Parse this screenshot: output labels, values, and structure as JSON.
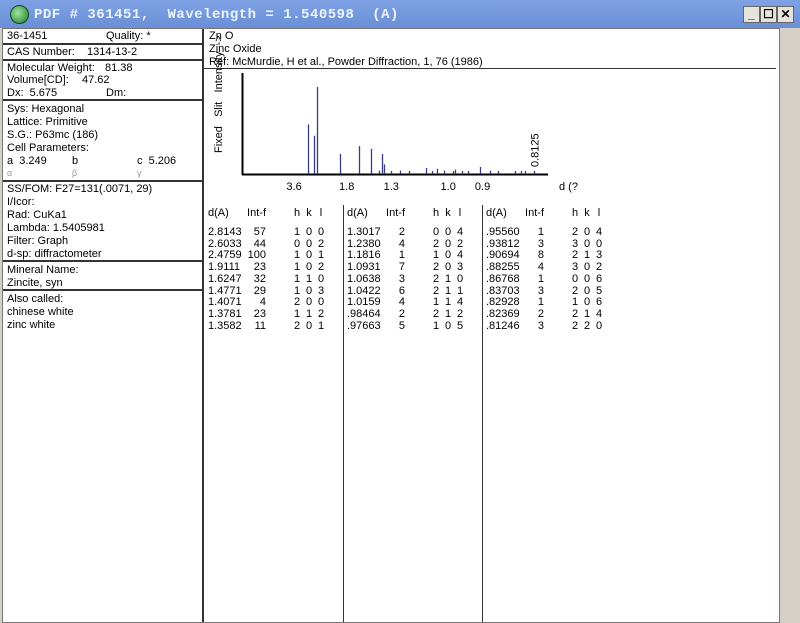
{
  "window": {
    "title": "PDF # 361451,  Wavelength = 1.540598  (A)",
    "minimize": "_",
    "maximize": "☐",
    "close": "✕"
  },
  "left": {
    "pdf_number": "36-1451",
    "quality": "Quality: *",
    "cas_label": "CAS Number:",
    "cas_value": "1314-13-2",
    "mw_label": "Molecular Weight:",
    "mw_value": "81.38",
    "vol_label": "Volume[CD]:",
    "vol_value": "47.62",
    "dx": "Dx:  5.675",
    "dm": "Dm:",
    "sys": "Sys: Hexagonal",
    "lattice": "Lattice: Primitive",
    "sg": "S.G.: P63mc (186)",
    "cell_label": "Cell Parameters:",
    "a": "a  3.249",
    "b": "b",
    "c": "c  5.206",
    "alpha": "α",
    "beta": "β",
    "gamma": "γ",
    "ssfom": "SS/FOM: F27=131(.0071, 29)",
    "icor": "I/Icor:",
    "rad": "Rad: CuKa1",
    "lambda": "Lambda: 1.5405981",
    "filter": "Filter: Graph",
    "dsp": "d-sp: diffractometer",
    "mineral_label": "Mineral Name:",
    "mineral": "Zincite, syn",
    "also_label": "Also called:",
    "also": [
      "chinese white",
      "zinc white"
    ]
  },
  "header": {
    "formula": "Zn O",
    "name": "Zinc Oxide",
    "ref": "Ref: McMurdie, H et al., Powder Diffraction, 1, 76 (1986)"
  },
  "chart_data": {
    "type": "bar",
    "ylabel": "Fixed   Slit   Intensity  ->",
    "xlabel": "d (?",
    "xticks": [
      "3.6",
      "1.8",
      "1.3",
      "1.0",
      "0.9"
    ],
    "xtick_values": [
      3.6,
      1.8,
      1.3,
      1.0,
      0.9
    ],
    "annotation": "0.8125",
    "wavelength": 1.540598,
    "x_range_2theta": [
      0,
      150
    ],
    "ylim": [
      0,
      100
    ],
    "peaks": [
      [
        2.8143,
        57
      ],
      [
        2.6033,
        44
      ],
      [
        2.4759,
        100
      ],
      [
        1.9111,
        23
      ],
      [
        1.6247,
        32
      ],
      [
        1.4771,
        29
      ],
      [
        1.4071,
        4
      ],
      [
        1.3781,
        23
      ],
      [
        1.3582,
        11
      ],
      [
        1.3017,
        2
      ],
      [
        1.238,
        4
      ],
      [
        1.1816,
        1
      ],
      [
        1.0931,
        7
      ],
      [
        1.0638,
        3
      ],
      [
        1.0422,
        6
      ],
      [
        1.0159,
        4
      ],
      [
        0.98464,
        2
      ],
      [
        0.97663,
        5
      ],
      [
        0.9556,
        1
      ],
      [
        0.93812,
        3
      ],
      [
        0.90694,
        8
      ],
      [
        0.88255,
        4
      ],
      [
        0.86768,
        1
      ],
      [
        0.83703,
        3
      ],
      [
        0.82928,
        1
      ],
      [
        0.82369,
        2
      ],
      [
        0.81246,
        3
      ]
    ]
  },
  "table": {
    "headers": [
      "d(A)",
      "Int-f",
      "h",
      "k",
      "l"
    ],
    "columns": [
      [
        [
          "2.8143",
          "57",
          "1",
          "0",
          "0"
        ],
        [
          "2.6033",
          "44",
          "0",
          "0",
          "2"
        ],
        [
          "2.4759",
          "100",
          "1",
          "0",
          "1"
        ],
        [
          "1.9111",
          "23",
          "1",
          "0",
          "2"
        ],
        [
          "1.6247",
          "32",
          "1",
          "1",
          "0"
        ],
        [
          "1.4771",
          "29",
          "1",
          "0",
          "3"
        ],
        [
          "1.4071",
          "4",
          "2",
          "0",
          "0"
        ],
        [
          "1.3781",
          "23",
          "1",
          "1",
          "2"
        ],
        [
          "1.3582",
          "11",
          "2",
          "0",
          "1"
        ]
      ],
      [
        [
          "1.3017",
          "2",
          "0",
          "0",
          "4"
        ],
        [
          "1.2380",
          "4",
          "2",
          "0",
          "2"
        ],
        [
          "1.1816",
          "1",
          "1",
          "0",
          "4"
        ],
        [
          "1.0931",
          "7",
          "2",
          "0",
          "3"
        ],
        [
          "1.0638",
          "3",
          "2",
          "1",
          "0"
        ],
        [
          "1.0422",
          "6",
          "2",
          "1",
          "1"
        ],
        [
          "1.0159",
          "4",
          "1",
          "1",
          "4"
        ],
        [
          ".98464",
          "2",
          "2",
          "1",
          "2"
        ],
        [
          ".97663",
          "5",
          "1",
          "0",
          "5"
        ]
      ],
      [
        [
          ".95560",
          "1",
          "2",
          "0",
          "4"
        ],
        [
          ".93812",
          "3",
          "3",
          "0",
          "0"
        ],
        [
          ".90694",
          "8",
          "2",
          "1",
          "3"
        ],
        [
          ".88255",
          "4",
          "3",
          "0",
          "2"
        ],
        [
          ".86768",
          "1",
          "0",
          "0",
          "6"
        ],
        [
          ".83703",
          "3",
          "2",
          "0",
          "5"
        ],
        [
          ".82928",
          "1",
          "1",
          "0",
          "6"
        ],
        [
          ".82369",
          "2",
          "2",
          "1",
          "4"
        ],
        [
          ".81246",
          "3",
          "2",
          "2",
          "0"
        ]
      ]
    ]
  }
}
